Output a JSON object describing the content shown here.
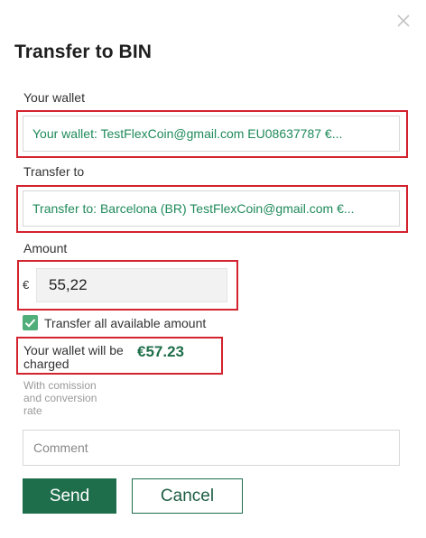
{
  "dialog": {
    "title": "Transfer to BIN",
    "close_icon": "close-x-icon"
  },
  "wallet": {
    "label": "Your wallet",
    "value": "Your wallet: TestFlexCoin@gmail.com EU08637787 €..."
  },
  "transfer_to": {
    "label": "Transfer to",
    "value": "Transfer to: Barcelona (BR) TestFlexCoin@gmail.com €..."
  },
  "amount": {
    "label": "Amount",
    "currency_symbol": "€",
    "value": "55,22"
  },
  "transfer_all": {
    "label": "Transfer all available amount",
    "checked": true
  },
  "charge": {
    "label": "Your wallet will be charged",
    "amount": "€57.23",
    "note": "With comission and conversion rate"
  },
  "comment": {
    "placeholder": "Comment",
    "value": ""
  },
  "actions": {
    "send_label": "Send",
    "cancel_label": "Cancel"
  },
  "colors": {
    "accent_green": "#1e6e4c",
    "link_green": "#1f8a5a",
    "checkbox_green": "#4fae7a",
    "highlight_red": "#d3232e"
  }
}
